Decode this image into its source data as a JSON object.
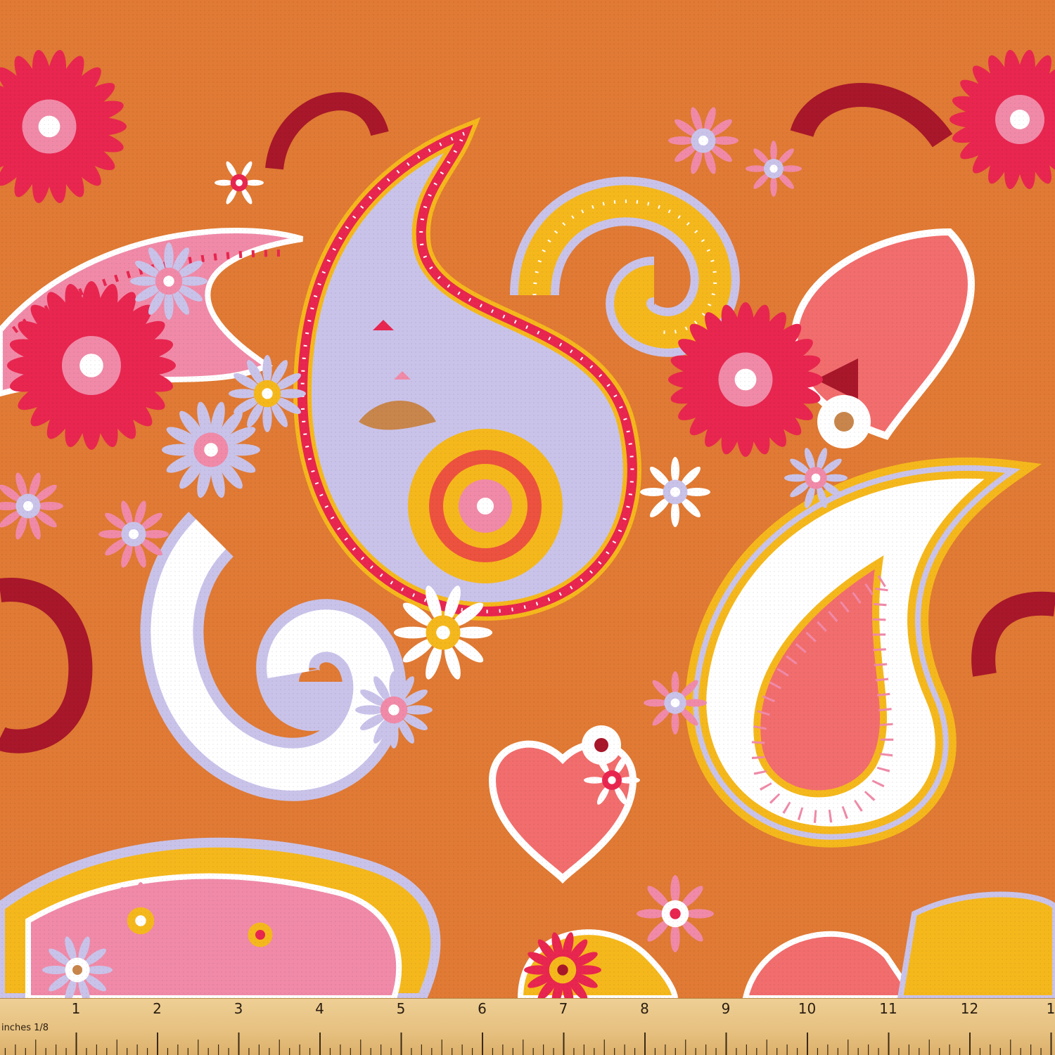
{
  "image": {
    "subject": "paisley-floral-fabric",
    "colors": {
      "background": "#e07a34",
      "yellow": "#f5b81c",
      "pink": "#f08aa8",
      "red": "#e8264f",
      "maroon": "#a8172a",
      "lavender": "#c9c3ea",
      "white": "#ffffff",
      "coral": "#f26d6d",
      "tan": "#c8864c"
    }
  },
  "ruler": {
    "unit_label": "inches 1/8",
    "numbers": [
      "1",
      "2",
      "3",
      "4",
      "5",
      "6",
      "7",
      "8",
      "9",
      "10",
      "11",
      "12",
      "1"
    ]
  }
}
